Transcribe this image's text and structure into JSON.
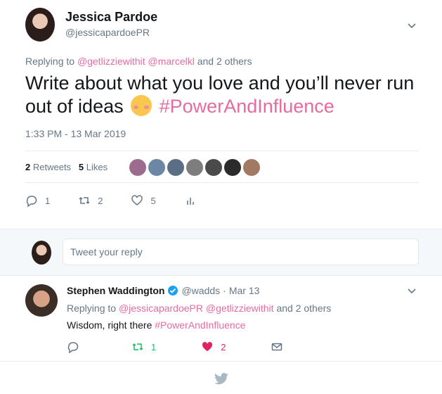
{
  "main_tweet": {
    "author_name": "Jessica Pardoe",
    "author_handle": "@jessicapardoePR",
    "replying_to_prefix": "Replying to",
    "replying_mentions": "@getlizziewithit @marcelkl",
    "replying_suffix": "and 2 others",
    "text_part1": "Write about what you love and you’ll never run out of ideas",
    "hashtag": "#PowerAndInfluence",
    "timestamp": "1:33 PM - 13 Mar 2019",
    "retweets_count": "2",
    "retweets_label": "Retweets",
    "likes_count": "5",
    "likes_label": "Likes",
    "reply_count": "1",
    "retweet_count": "2",
    "like_count": "5"
  },
  "composer": {
    "placeholder": "Tweet your reply"
  },
  "reply_tweet": {
    "author_name": "Stephen Waddington",
    "author_handle": "@wadds",
    "separator": "·",
    "date": "Mar 13",
    "replying_to_prefix": "Replying to",
    "replying_mentions": "@jessicapardoePR @getlizziewithit",
    "replying_suffix": "and 2 others",
    "text": "Wisdom, right there",
    "hashtag": "#PowerAndInfluence",
    "retweet_count": "1",
    "like_count": "2"
  },
  "colors": {
    "pink_link": "#e56ba2",
    "muted": "#657786",
    "green": "#17bf63",
    "like_red": "#e0245e"
  }
}
